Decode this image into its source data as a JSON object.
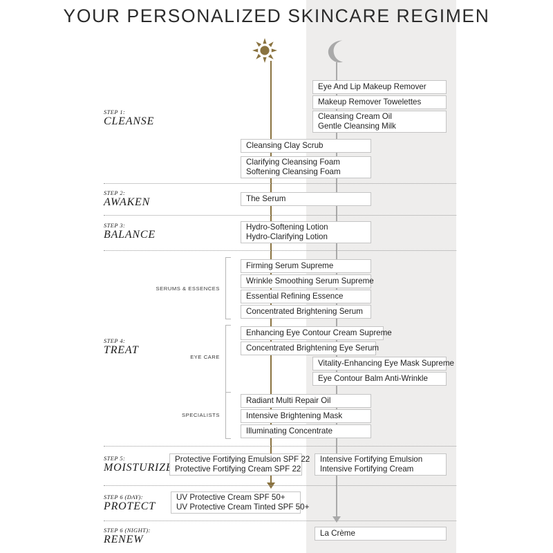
{
  "page": {
    "title": "YOUR PERSONALIZED SKINCARE REGIMEN",
    "colors": {
      "day_accent": "#8a7340",
      "night_accent": "#a9a9a9",
      "night_panel": "#eeedec",
      "box_border": "#c4c4c4",
      "text": "#232323"
    }
  },
  "columns": {
    "day": {
      "icon": "sun-icon",
      "label": "Day"
    },
    "night": {
      "icon": "moon-icon",
      "label": "Night"
    }
  },
  "steps": [
    {
      "kicker": "STEP 1:",
      "name": "CLEANSE"
    },
    {
      "kicker": "STEP 2:",
      "name": "AWAKEN"
    },
    {
      "kicker": "STEP 3:",
      "name": "BALANCE"
    },
    {
      "kicker": "STEP 4:",
      "name": "TREAT"
    },
    {
      "kicker": "STEP 5:",
      "name": "MOISTURIZE"
    },
    {
      "kicker": "STEP 6 (DAY):",
      "name": "PROTECT"
    },
    {
      "kicker": "STEP 6 (NIGHT):",
      "name": "RENEW"
    }
  ],
  "groups": [
    {
      "label": "SERUMS & ESSENCES"
    },
    {
      "label": "EYE CARE"
    },
    {
      "label": "SPECIALISTS"
    }
  ],
  "products": {
    "cleanse_night_1": {
      "lines": [
        "Eye And Lip Makeup Remover"
      ]
    },
    "cleanse_night_2": {
      "lines": [
        "Makeup Remover Towelettes"
      ]
    },
    "cleanse_night_3": {
      "lines": [
        "Cleansing Cream Oil",
        "Gentle Cleansing Milk"
      ]
    },
    "cleanse_both_1": {
      "lines": [
        "Cleansing Clay Scrub"
      ]
    },
    "cleanse_both_2": {
      "lines": [
        "Clarifying Cleansing Foam",
        "Softening Cleansing Foam"
      ]
    },
    "awaken_1": {
      "lines": [
        "The Serum"
      ]
    },
    "balance_1": {
      "lines": [
        "Hydro-Softening Lotion",
        "Hydro-Clarifying Lotion"
      ]
    },
    "serums_1": {
      "lines": [
        "Firming Serum Supreme"
      ]
    },
    "serums_2": {
      "lines": [
        "Wrinkle Smoothing Serum Supreme"
      ]
    },
    "serums_3": {
      "lines": [
        "Essential Refining Essence"
      ]
    },
    "serums_4": {
      "lines": [
        "Concentrated Brightening Serum"
      ]
    },
    "eye_1": {
      "lines": [
        "Enhancing Eye Contour Cream Supreme"
      ]
    },
    "eye_2": {
      "lines": [
        "Concentrated Brightening Eye Serum"
      ]
    },
    "eye_3": {
      "lines": [
        "Vitality-Enhancing Eye Mask Supreme"
      ]
    },
    "eye_4": {
      "lines": [
        "Eye Contour Balm Anti-Wrinkle"
      ]
    },
    "spec_1": {
      "lines": [
        "Radiant Multi Repair Oil"
      ]
    },
    "spec_2": {
      "lines": [
        "Intensive Brightening Mask"
      ]
    },
    "spec_3": {
      "lines": [
        "Illuminating Concentrate"
      ]
    },
    "moist_day": {
      "lines": [
        "Protective Fortifying Emulsion SPF 22",
        "Protective Fortifying Cream SPF 22"
      ]
    },
    "moist_night": {
      "lines": [
        "Intensive Fortifying Emulsion",
        "Intensive Fortifying Cream"
      ]
    },
    "protect_day": {
      "lines": [
        "UV Protective Cream SPF 50+",
        "UV Protective Cream Tinted SPF 50+"
      ]
    },
    "renew_night": {
      "lines": [
        "La Crème"
      ]
    }
  }
}
